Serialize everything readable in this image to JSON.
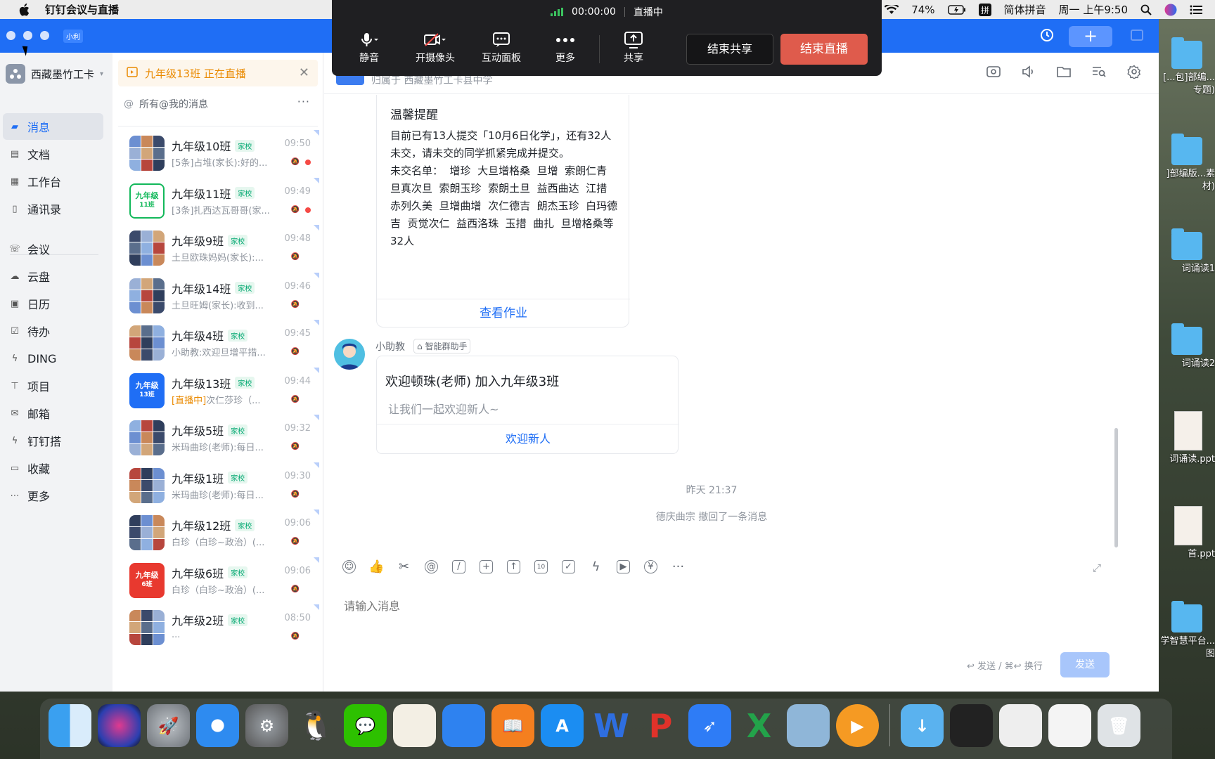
{
  "menubar": {
    "app_name": "钉钉会议与直播",
    "battery": "74%",
    "input_method": "简体拼音",
    "clock": "周一 上午9:50"
  },
  "live_bar": {
    "timer": "00:00:00",
    "status": "直播中",
    "buttons": [
      "静音",
      "开摄像头",
      "互动面板",
      "更多",
      "共享"
    ],
    "end_share": "结束共享",
    "end_live": "结束直播"
  },
  "window": {
    "badge": "小利",
    "new_label": "+"
  },
  "nav": {
    "org_name": "西藏墨竹工卡",
    "items": [
      "消息",
      "文档",
      "工作台",
      "通讯录",
      "会议",
      "云盘",
      "日历",
      "待办",
      "DING",
      "项目",
      "邮箱",
      "钉钉搭",
      "收藏",
      "更多"
    ]
  },
  "live_banner": "九年级13班 正在直播",
  "filter_label": "所有@我的消息",
  "conversations": [
    {
      "title": "九年级10班",
      "tag": "家校",
      "time": "09:50",
      "preview": "[5条]占堆(家长):好的...",
      "unread": true
    },
    {
      "title": "九年级11班",
      "tag": "家校",
      "time": "09:49",
      "preview": "[3条]扎西达瓦哥哥(家...",
      "unread": true,
      "avatar_text": "九年级 11班"
    },
    {
      "title": "九年级9班",
      "tag": "家校",
      "time": "09:48",
      "preview": "土旦欧珠妈妈(家长):..."
    },
    {
      "title": "九年级14班",
      "tag": "家校",
      "time": "09:46",
      "preview": "土旦旺姆(家长):收到..."
    },
    {
      "title": "九年级4班",
      "tag": "家校",
      "time": "09:45",
      "preview": "小助教:欢迎旦增平措..."
    },
    {
      "title": "九年级13班",
      "tag": "家校",
      "time": "09:44",
      "preview_live": "[直播中]",
      "preview": "次仁莎珍（...",
      "avatar_text": "九年级 13班"
    },
    {
      "title": "九年级5班",
      "tag": "家校",
      "time": "09:32",
      "preview": "米玛曲珍(老师):每日..."
    },
    {
      "title": "九年级1班",
      "tag": "家校",
      "time": "09:30",
      "preview": "米玛曲珍(老师):每日..."
    },
    {
      "title": "九年级12班",
      "tag": "家校",
      "time": "09:06",
      "preview": "白珍（白珍~政治）(..."
    },
    {
      "title": "九年级6班",
      "tag": "家校",
      "time": "09:06",
      "preview": "白珍（白珍~政治）(...",
      "avatar_text": "九年级 6班"
    },
    {
      "title": "九年级2班",
      "tag": "家校",
      "time": "08:50",
      "preview": "..."
    }
  ],
  "chat": {
    "subline": "归属于 西藏墨竹工卡县中学",
    "reminder_card": {
      "title": "温馨提醒",
      "body": "目前已有13人提交「10月6日化学」，还有32人未交，请未交的同学抓紧完成并提交。\n未交名单：  增珍  大旦增格桑  旦增  索朗仁青  旦真次旦  索朗玉珍  索朗土旦  益西曲达  江措  赤列久美  旦增曲增  次仁德吉  朗杰玉珍  白玛德吉  贡觉次仁  益西洛珠  玉措  曲扎  旦增格桑等32人",
      "button": "查看作业"
    },
    "bot_name": "小助教",
    "bot_badge": "智能群助手",
    "welcome_card": {
      "title": "欢迎顿珠(老师) 加入九年级3班",
      "subtitle": "让我们一起欢迎新人~",
      "button": "欢迎新人"
    },
    "system_time": "昨天 21:37",
    "system_recall": "德庆曲宗 撤回了一条消息",
    "input_placeholder": "请输入消息",
    "send_hint": "↩ 发送 / ⌘↩ 换行",
    "send_label": "发送"
  },
  "desktop_items": [
    "[...包]部编...专题)",
    "]部编版...素材)",
    "词诵读1",
    "词诵读2",
    "词诵读.ppt",
    "首.ppt",
    "学智慧平台...图"
  ]
}
